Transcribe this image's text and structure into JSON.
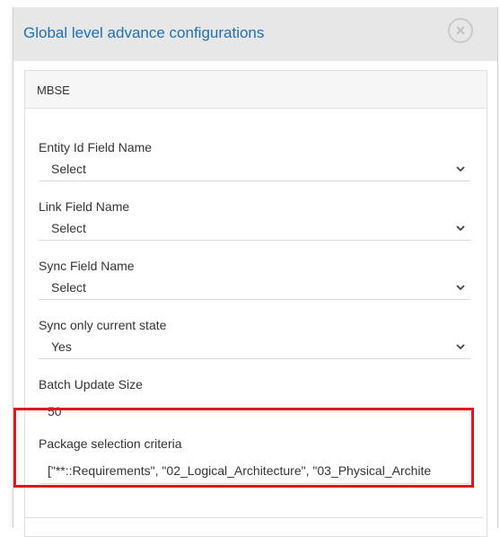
{
  "dialog": {
    "title": "Global level advance configurations",
    "close_symbol": "×"
  },
  "panel": {
    "heading": "MBSE",
    "fields": [
      {
        "label": "Entity Id Field Name",
        "value": "Select",
        "control": "select"
      },
      {
        "label": "Link Field Name",
        "value": "Select",
        "control": "select"
      },
      {
        "label": "Sync Field Name",
        "value": "Select",
        "control": "select"
      },
      {
        "label": "Sync only current state",
        "value": "Yes",
        "control": "select"
      },
      {
        "label": "Batch Update Size",
        "value": "50",
        "control": "input"
      },
      {
        "label": "Package selection criteria",
        "value": "[\"**::Requirements\", \"02_Logical_Architecture\", \"03_Physical_Archite",
        "control": "input"
      }
    ]
  },
  "icons": {
    "close": "close-circle-icon",
    "dropdown": "chevron-down-icon"
  },
  "colors": {
    "title": "#1f6fb2",
    "highlight": "#e0161d",
    "header_bg": "#e7e7e7"
  }
}
